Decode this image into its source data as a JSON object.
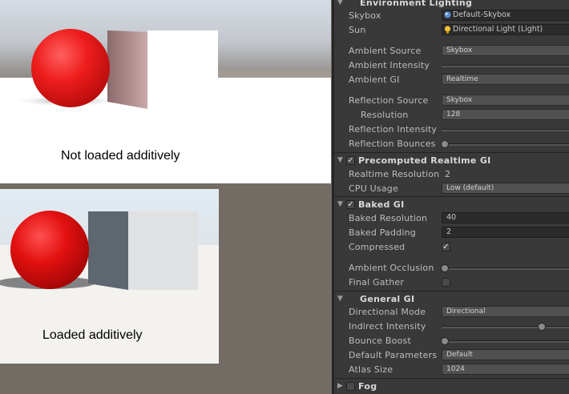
{
  "captions": {
    "top": "Not loaded additively",
    "bottom": "Loaded additively"
  },
  "environment_lighting": {
    "title": "Environment Lighting",
    "skybox_label": "Skybox",
    "skybox_value": "Default-Skybox",
    "sun_label": "Sun",
    "sun_value": "Directional Light (Light)",
    "ambient_source_label": "Ambient Source",
    "ambient_source_value": "Skybox",
    "ambient_intensity_label": "Ambient Intensity",
    "ambient_gi_label": "Ambient GI",
    "ambient_gi_value": "Realtime",
    "reflection_source_label": "Reflection Source",
    "reflection_source_value": "Skybox",
    "resolution_label": "Resolution",
    "resolution_value": "128",
    "reflection_intensity_label": "Reflection Intensity",
    "reflection_bounces_label": "Reflection Bounces"
  },
  "precomputed_realtime_gi": {
    "title": "Precomputed Realtime GI",
    "enabled": true,
    "realtime_resolution_label": "Realtime Resolution",
    "realtime_resolution_value": "2",
    "cpu_usage_label": "CPU Usage",
    "cpu_usage_value": "Low (default)"
  },
  "baked_gi": {
    "title": "Baked GI",
    "enabled": true,
    "baked_resolution_label": "Baked Resolution",
    "baked_resolution_value": "40",
    "baked_padding_label": "Baked Padding",
    "baked_padding_value": "2",
    "compressed_label": "Compressed",
    "compressed": true,
    "ambient_occlusion_label": "Ambient Occlusion",
    "final_gather_label": "Final Gather",
    "final_gather": false
  },
  "general_gi": {
    "title": "General GI",
    "directional_mode_label": "Directional Mode",
    "directional_mode_value": "Directional",
    "indirect_intensity_label": "Indirect Intensity",
    "bounce_boost_label": "Bounce Boost",
    "default_parameters_label": "Default Parameters",
    "default_parameters_value": "Default",
    "atlas_size_label": "Atlas Size",
    "atlas_size_value": "1024"
  },
  "fog": {
    "title": "Fog",
    "enabled": false
  },
  "icons": {
    "skybox": "sphere-material-icon",
    "sun": "light-bulb-icon",
    "fold_open": "triangle-down-icon",
    "fold_closed": "triangle-right-icon",
    "check": "checkmark-icon"
  },
  "colors": {
    "panel_bg": "#393939",
    "sphere": "#e31a1a",
    "background": "#736c64"
  }
}
